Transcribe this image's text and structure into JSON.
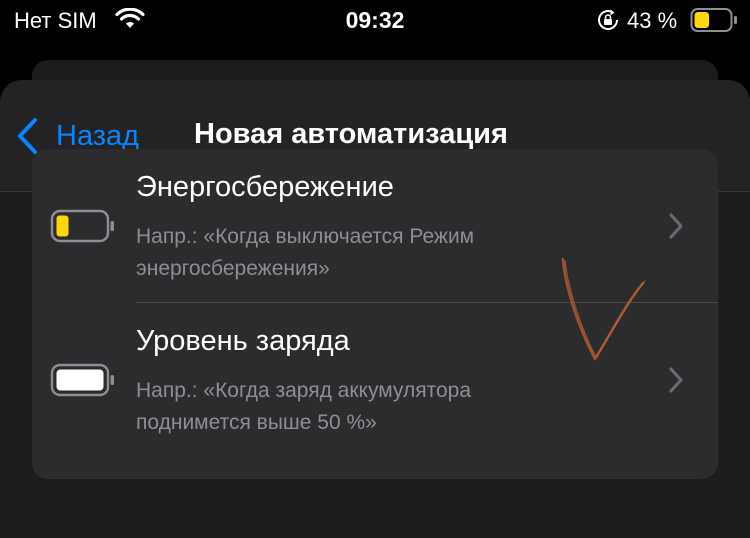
{
  "status_bar": {
    "carrier": "Нет SIM",
    "time": "09:32",
    "battery_percent": "43 %",
    "battery_level": 0.43,
    "icons": [
      "wifi-icon",
      "orientation-lock-icon",
      "battery-icon"
    ]
  },
  "nav": {
    "back_label": "Назад",
    "title": "Новая автоматизация",
    "back_icon": "chevron-left-icon"
  },
  "list": {
    "items": [
      {
        "title": "Энергосбережение",
        "subtitle": "Напр.: «Когда выключается Режим энергосбережения»",
        "icon": "low-power-battery-icon",
        "icon_color": "#ffd60a"
      },
      {
        "title": "Уровень заряда",
        "subtitle": "Напр.: «Когда заряд аккумулятора поднимется выше 50 %»",
        "icon": "battery-level-icon",
        "icon_color": "#ffffff"
      }
    ]
  },
  "colors": {
    "accent": "#0a84ff",
    "background": "#000000",
    "sheet": "#1c1c1e",
    "row": "#2c2c2e",
    "secondary_text": "#8e8e93",
    "annotation": "#a0522d"
  }
}
